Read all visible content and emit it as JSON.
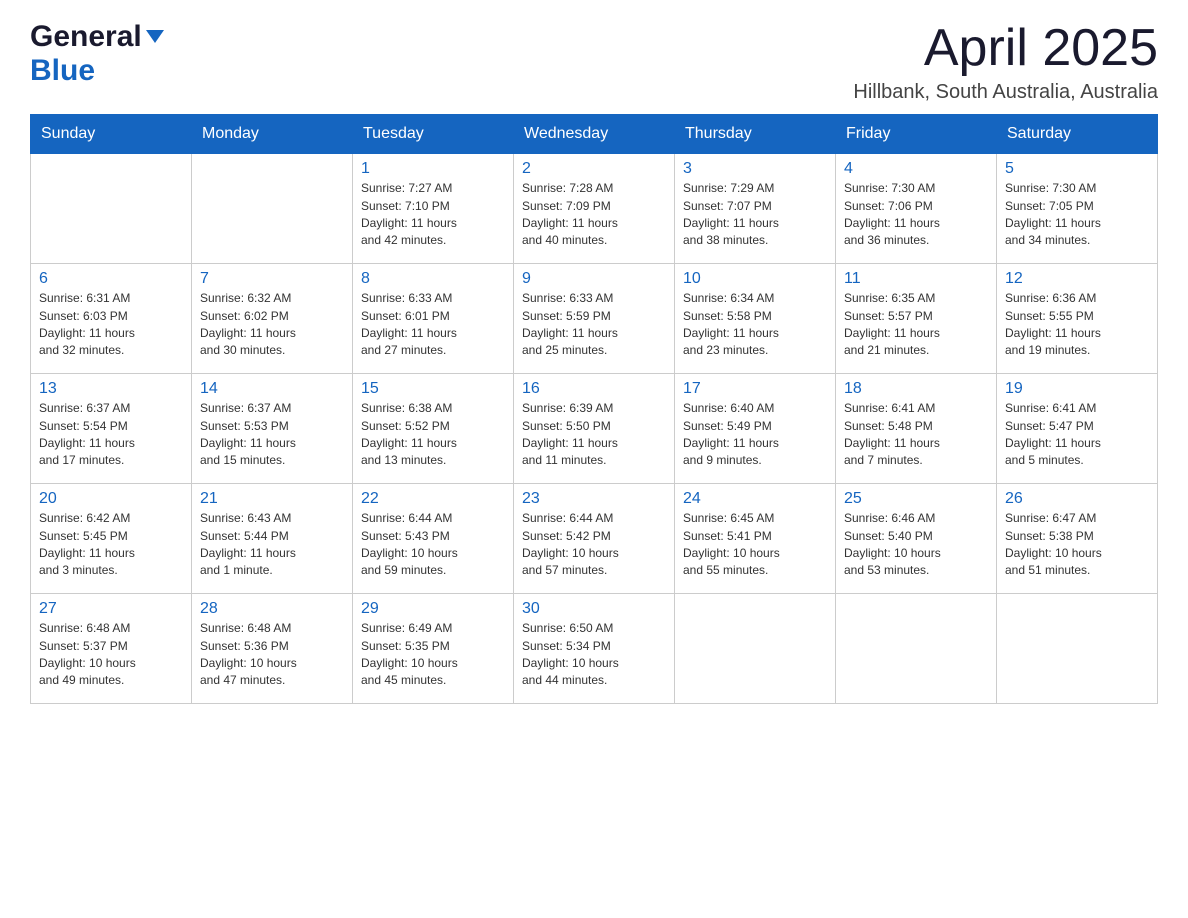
{
  "header": {
    "logo_general": "General",
    "logo_blue": "Blue",
    "month_year": "April 2025",
    "location": "Hillbank, South Australia, Australia"
  },
  "days_of_week": [
    "Sunday",
    "Monday",
    "Tuesday",
    "Wednesday",
    "Thursday",
    "Friday",
    "Saturday"
  ],
  "weeks": [
    [
      {
        "day": "",
        "info": ""
      },
      {
        "day": "",
        "info": ""
      },
      {
        "day": "1",
        "info": "Sunrise: 7:27 AM\nSunset: 7:10 PM\nDaylight: 11 hours\nand 42 minutes."
      },
      {
        "day": "2",
        "info": "Sunrise: 7:28 AM\nSunset: 7:09 PM\nDaylight: 11 hours\nand 40 minutes."
      },
      {
        "day": "3",
        "info": "Sunrise: 7:29 AM\nSunset: 7:07 PM\nDaylight: 11 hours\nand 38 minutes."
      },
      {
        "day": "4",
        "info": "Sunrise: 7:30 AM\nSunset: 7:06 PM\nDaylight: 11 hours\nand 36 minutes."
      },
      {
        "day": "5",
        "info": "Sunrise: 7:30 AM\nSunset: 7:05 PM\nDaylight: 11 hours\nand 34 minutes."
      }
    ],
    [
      {
        "day": "6",
        "info": "Sunrise: 6:31 AM\nSunset: 6:03 PM\nDaylight: 11 hours\nand 32 minutes."
      },
      {
        "day": "7",
        "info": "Sunrise: 6:32 AM\nSunset: 6:02 PM\nDaylight: 11 hours\nand 30 minutes."
      },
      {
        "day": "8",
        "info": "Sunrise: 6:33 AM\nSunset: 6:01 PM\nDaylight: 11 hours\nand 27 minutes."
      },
      {
        "day": "9",
        "info": "Sunrise: 6:33 AM\nSunset: 5:59 PM\nDaylight: 11 hours\nand 25 minutes."
      },
      {
        "day": "10",
        "info": "Sunrise: 6:34 AM\nSunset: 5:58 PM\nDaylight: 11 hours\nand 23 minutes."
      },
      {
        "day": "11",
        "info": "Sunrise: 6:35 AM\nSunset: 5:57 PM\nDaylight: 11 hours\nand 21 minutes."
      },
      {
        "day": "12",
        "info": "Sunrise: 6:36 AM\nSunset: 5:55 PM\nDaylight: 11 hours\nand 19 minutes."
      }
    ],
    [
      {
        "day": "13",
        "info": "Sunrise: 6:37 AM\nSunset: 5:54 PM\nDaylight: 11 hours\nand 17 minutes."
      },
      {
        "day": "14",
        "info": "Sunrise: 6:37 AM\nSunset: 5:53 PM\nDaylight: 11 hours\nand 15 minutes."
      },
      {
        "day": "15",
        "info": "Sunrise: 6:38 AM\nSunset: 5:52 PM\nDaylight: 11 hours\nand 13 minutes."
      },
      {
        "day": "16",
        "info": "Sunrise: 6:39 AM\nSunset: 5:50 PM\nDaylight: 11 hours\nand 11 minutes."
      },
      {
        "day": "17",
        "info": "Sunrise: 6:40 AM\nSunset: 5:49 PM\nDaylight: 11 hours\nand 9 minutes."
      },
      {
        "day": "18",
        "info": "Sunrise: 6:41 AM\nSunset: 5:48 PM\nDaylight: 11 hours\nand 7 minutes."
      },
      {
        "day": "19",
        "info": "Sunrise: 6:41 AM\nSunset: 5:47 PM\nDaylight: 11 hours\nand 5 minutes."
      }
    ],
    [
      {
        "day": "20",
        "info": "Sunrise: 6:42 AM\nSunset: 5:45 PM\nDaylight: 11 hours\nand 3 minutes."
      },
      {
        "day": "21",
        "info": "Sunrise: 6:43 AM\nSunset: 5:44 PM\nDaylight: 11 hours\nand 1 minute."
      },
      {
        "day": "22",
        "info": "Sunrise: 6:44 AM\nSunset: 5:43 PM\nDaylight: 10 hours\nand 59 minutes."
      },
      {
        "day": "23",
        "info": "Sunrise: 6:44 AM\nSunset: 5:42 PM\nDaylight: 10 hours\nand 57 minutes."
      },
      {
        "day": "24",
        "info": "Sunrise: 6:45 AM\nSunset: 5:41 PM\nDaylight: 10 hours\nand 55 minutes."
      },
      {
        "day": "25",
        "info": "Sunrise: 6:46 AM\nSunset: 5:40 PM\nDaylight: 10 hours\nand 53 minutes."
      },
      {
        "day": "26",
        "info": "Sunrise: 6:47 AM\nSunset: 5:38 PM\nDaylight: 10 hours\nand 51 minutes."
      }
    ],
    [
      {
        "day": "27",
        "info": "Sunrise: 6:48 AM\nSunset: 5:37 PM\nDaylight: 10 hours\nand 49 minutes."
      },
      {
        "day": "28",
        "info": "Sunrise: 6:48 AM\nSunset: 5:36 PM\nDaylight: 10 hours\nand 47 minutes."
      },
      {
        "day": "29",
        "info": "Sunrise: 6:49 AM\nSunset: 5:35 PM\nDaylight: 10 hours\nand 45 minutes."
      },
      {
        "day": "30",
        "info": "Sunrise: 6:50 AM\nSunset: 5:34 PM\nDaylight: 10 hours\nand 44 minutes."
      },
      {
        "day": "",
        "info": ""
      },
      {
        "day": "",
        "info": ""
      },
      {
        "day": "",
        "info": ""
      }
    ]
  ]
}
